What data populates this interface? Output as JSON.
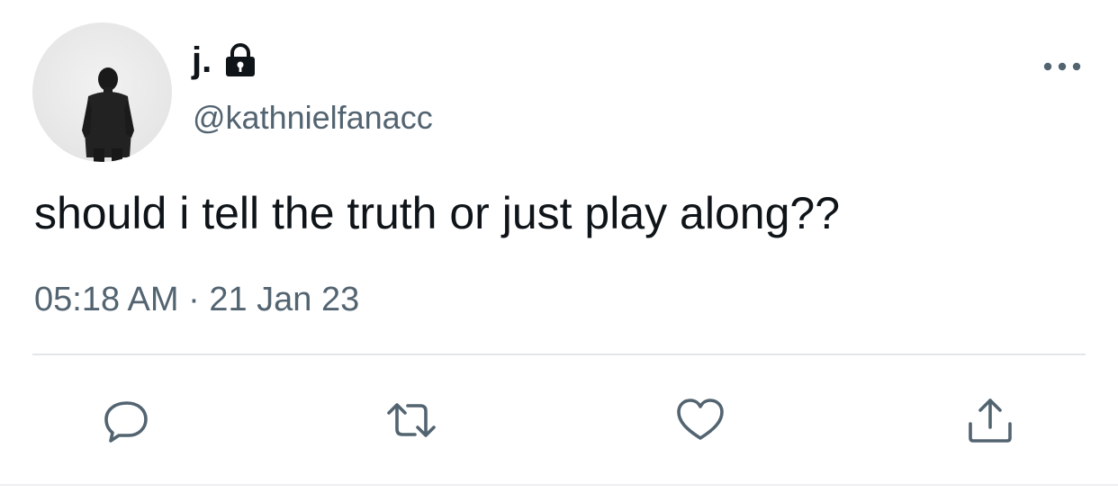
{
  "user": {
    "display_name": "j.",
    "handle": "@kathnielfanacc",
    "protected_icon": "lock-icon",
    "avatar": "avatar-man-in-suit"
  },
  "tweet": {
    "text": "should i tell the truth or just play along??",
    "time": "05:18 AM",
    "separator": "·",
    "date": "21 Jan 23"
  },
  "actions": {
    "reply": "reply-icon",
    "retweet": "retweet-icon",
    "like": "heart-icon",
    "share": "share-icon",
    "more": "more-icon"
  },
  "colors": {
    "text": "#0f1419",
    "secondary": "#536471",
    "divider": "#e3e6e8"
  }
}
